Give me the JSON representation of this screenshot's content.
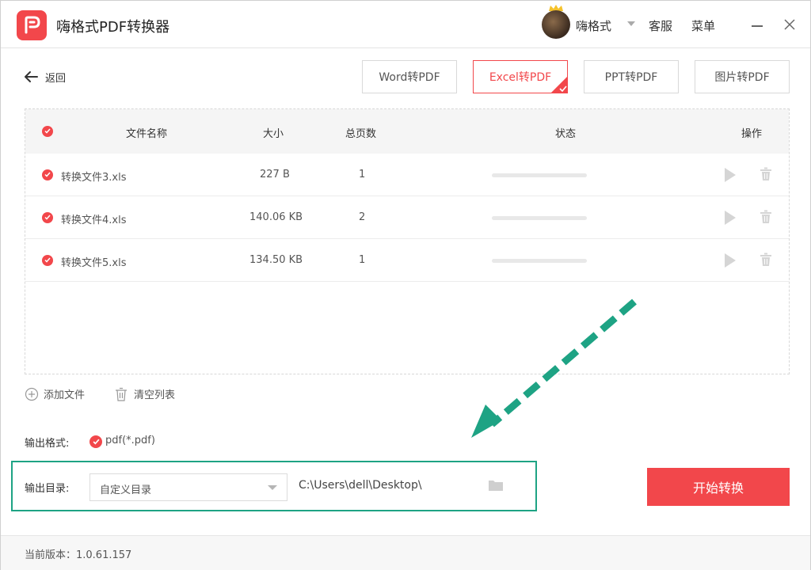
{
  "app": {
    "title": "嗨格式PDF转换器",
    "username": "嗨格式",
    "service": "客服",
    "menu": "菜单",
    "brand_color": "#f2474b",
    "accent_color": "#1ea384"
  },
  "nav": {
    "back_label": "返回",
    "tabs": [
      {
        "label": "Word转PDF",
        "active": false
      },
      {
        "label": "Excel转PDF",
        "active": true
      },
      {
        "label": "PPT转PDF",
        "active": false
      },
      {
        "label": "图片转PDF",
        "active": false
      }
    ]
  },
  "table": {
    "headers": {
      "name": "文件名称",
      "size": "大小",
      "pages": "总页数",
      "status": "状态",
      "actions": "操作"
    },
    "rows": [
      {
        "name": "转换文件3.xls",
        "size": "227 B",
        "pages": "1",
        "progress": 0
      },
      {
        "name": "转换文件4.xls",
        "size": "140.06 KB",
        "pages": "2",
        "progress": 0
      },
      {
        "name": "转换文件5.xls",
        "size": "134.50 KB",
        "pages": "1",
        "progress": 0
      }
    ]
  },
  "toolbar": {
    "add_file": "添加文件",
    "clear_list": "清空列表"
  },
  "output": {
    "format_label": "输出格式:",
    "format_value": "pdf(*.pdf)",
    "dir_label": "输出目录:",
    "dir_mode": "自定义目录",
    "dir_path": "C:\\Users\\dell\\Desktop\\",
    "start_button": "开始转换"
  },
  "footer": {
    "version": "当前版本：1.0.61.157"
  }
}
